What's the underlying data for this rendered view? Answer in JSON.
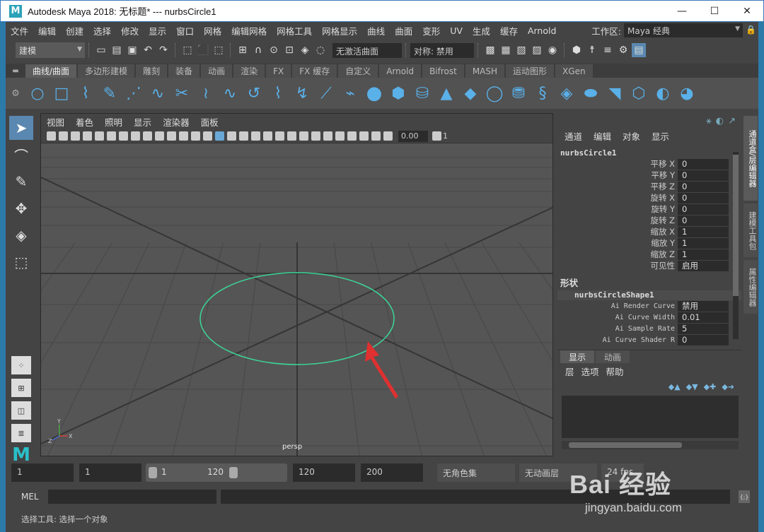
{
  "window": {
    "title": "Autodesk Maya 2018: 无标题*   ---   nurbsCircle1",
    "logo": "M",
    "minimize": "—",
    "maximize": "☐",
    "close": "✕"
  },
  "menubar": {
    "items": [
      "文件",
      "编辑",
      "创建",
      "选择",
      "修改",
      "显示",
      "窗口",
      "网格",
      "编辑网格",
      "网格工具",
      "网格显示",
      "曲线",
      "曲面",
      "变形",
      "UV",
      "生成",
      "缓存",
      "Arnold"
    ],
    "workspace_label": "工作区:",
    "workspace_value": "Maya 经典"
  },
  "statusline": {
    "mode": "建模",
    "live_surface": "无激活曲面",
    "symmetry": "对称: 禁用"
  },
  "shelf": {
    "tabs": [
      "曲线/曲面",
      "多边形建模",
      "雕刻",
      "装备",
      "动画",
      "渲染",
      "FX",
      "FX 缓存",
      "自定义",
      "Arnold",
      "Bifrost",
      "MASH",
      "运动图形",
      "XGen"
    ],
    "active_tab": 0
  },
  "viewport": {
    "menu": [
      "视图",
      "着色",
      "照明",
      "显示",
      "渲染器",
      "面板"
    ],
    "exposure": "0.00",
    "gamma": "1",
    "camera_label": "persp",
    "axis": {
      "y": "Y",
      "x": "X",
      "z": "Z"
    }
  },
  "channel_box": {
    "menu": [
      "通道",
      "编辑",
      "对象",
      "显示"
    ],
    "object": "nurbsCircle1",
    "attributes": [
      {
        "name": "平移 X",
        "value": "0"
      },
      {
        "name": "平移 Y",
        "value": "0"
      },
      {
        "name": "平移 Z",
        "value": "0"
      },
      {
        "name": "旋转 X",
        "value": "0"
      },
      {
        "name": "旋转 Y",
        "value": "0"
      },
      {
        "name": "旋转 Z",
        "value": "0"
      },
      {
        "name": "缩放 X",
        "value": "1"
      },
      {
        "name": "缩放 Y",
        "value": "1"
      },
      {
        "name": "缩放 Z",
        "value": "1"
      },
      {
        "name": "可见性",
        "value": "启用"
      }
    ],
    "shapes_header": "形状",
    "shape_name": "nurbsCircleShape1",
    "shape_attributes": [
      {
        "name": "Ai Render Curve",
        "value": "禁用"
      },
      {
        "name": "Ai Curve Width",
        "value": "0.01"
      },
      {
        "name": "Ai Sample Rate",
        "value": "5"
      },
      {
        "name": "Ai Curve Shader R",
        "value": "0"
      }
    ]
  },
  "side_tabs": [
    "通道盒/层编辑器",
    "建模工具包",
    "属性编辑器"
  ],
  "layer_editor": {
    "tabs": [
      "显示",
      "动画"
    ],
    "menu": [
      "层",
      "选项",
      "帮助"
    ]
  },
  "time_range": {
    "start": "1",
    "playback_start": "1",
    "slider_start": "1",
    "slider_end": "120",
    "playback_end": "120",
    "end": "200",
    "char_set": "无角色集",
    "anim_layer": "无动画层",
    "fps": "24 fps"
  },
  "command_line": {
    "lang": "MEL"
  },
  "help_line": "选择工具: 选择一个对象",
  "watermark": {
    "brand": "Bai 经验",
    "url": "jingyan.baidu.com"
  },
  "colors": {
    "selected_curve": "#3cd89a",
    "arrow": "#e03030",
    "accent": "#5a88b0"
  }
}
